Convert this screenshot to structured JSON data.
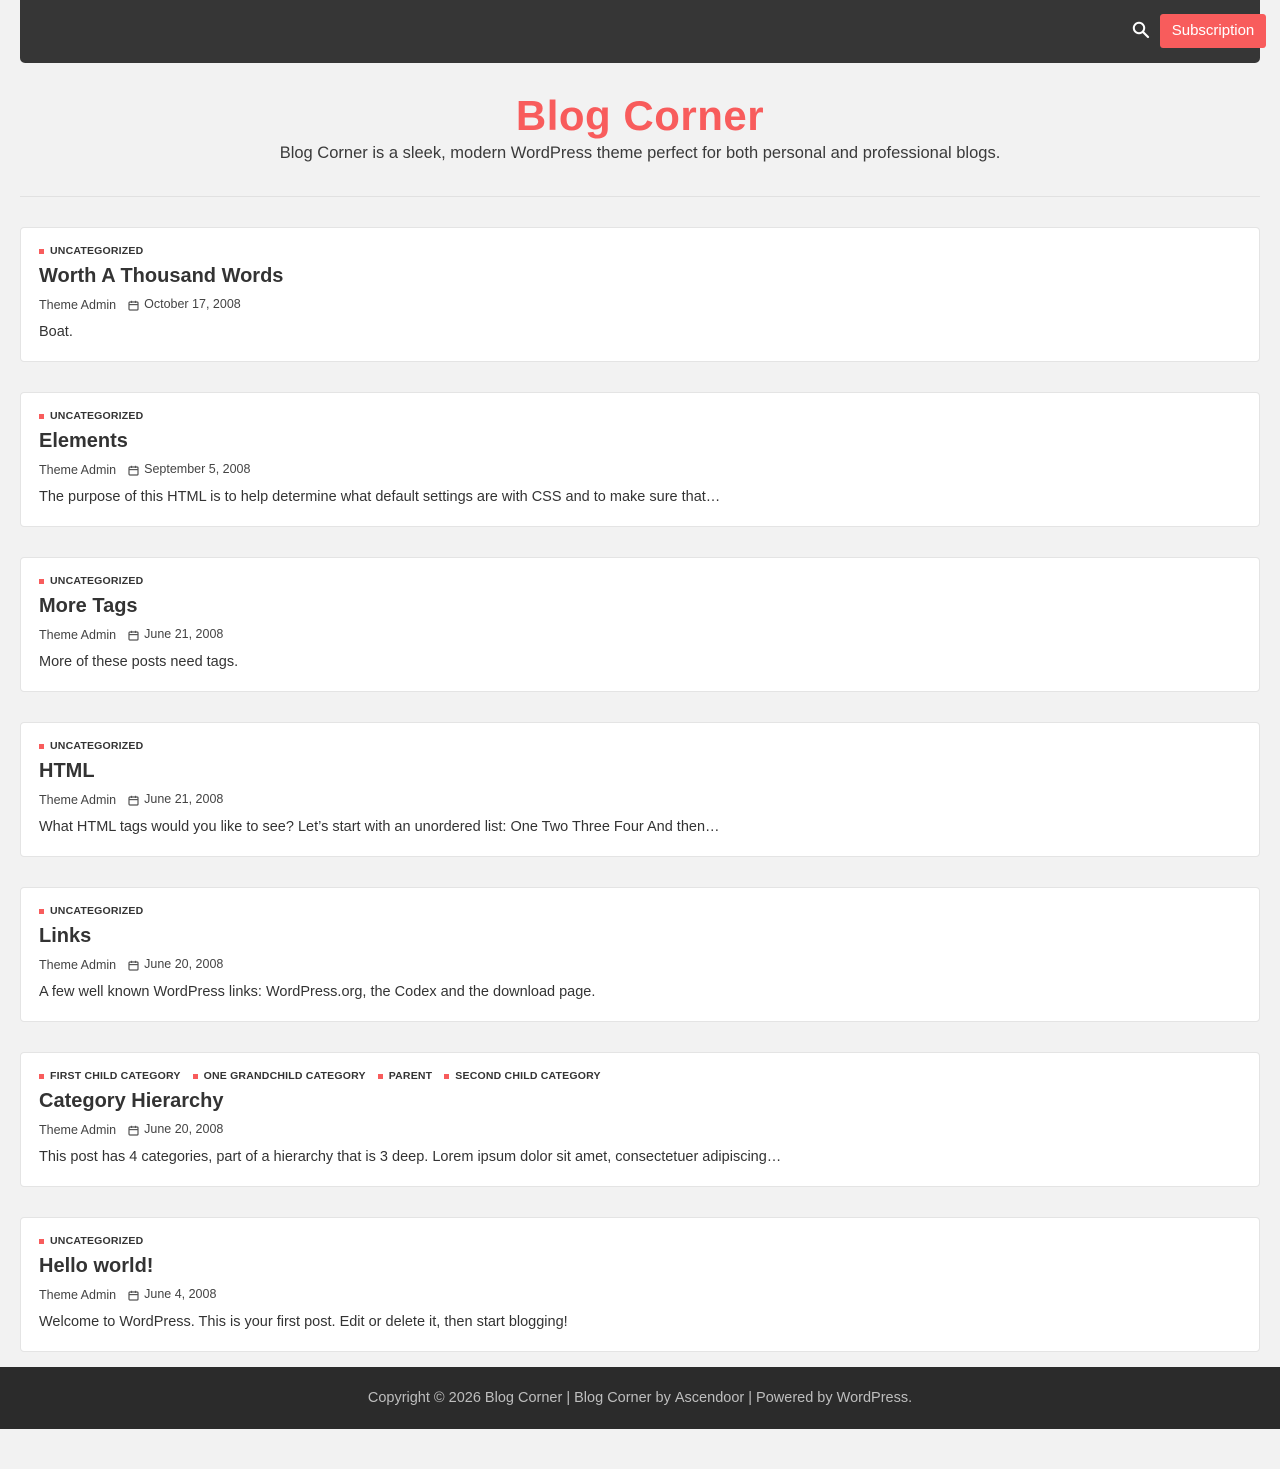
{
  "header": {
    "subscription_label": "Subscription",
    "search_icon": "search-icon",
    "site_title": "Blog Corner",
    "site_description": "Blog Corner is a sleek, modern WordPress theme perfect for both personal and professional blogs."
  },
  "colors": {
    "accent": "#f85c5c",
    "topbar": "#363636",
    "footer": "#2b2b2b",
    "page_background": "#f2f2f2"
  },
  "posts": [
    {
      "categories": [
        "Uncategorized"
      ],
      "title": "Worth A Thousand Words",
      "author": "Theme Admin",
      "date": "October 17, 2008",
      "excerpt": "Boat."
    },
    {
      "categories": [
        "Uncategorized"
      ],
      "title": "Elements",
      "author": "Theme Admin",
      "date": "September 5, 2008",
      "excerpt": "The purpose of this HTML is to help determine what default settings are with CSS and to make sure that…"
    },
    {
      "categories": [
        "Uncategorized"
      ],
      "title": "More Tags",
      "author": "Theme Admin",
      "date": "June 21, 2008",
      "excerpt": "More of these posts need tags."
    },
    {
      "categories": [
        "Uncategorized"
      ],
      "title": "HTML",
      "author": "Theme Admin",
      "date": "June 21, 2008",
      "excerpt": "What HTML tags would you like to see? Let’s start with an unordered list: One Two Three Four And then…"
    },
    {
      "categories": [
        "Uncategorized"
      ],
      "title": "Links",
      "author": "Theme Admin",
      "date": "June 20, 2008",
      "excerpt": "A few well known WordPress links: WordPress.org, the Codex and the download page."
    },
    {
      "categories": [
        "First Child Category",
        "One Grandchild Category",
        "Parent",
        "Second Child Category"
      ],
      "title": "Category Hierarchy",
      "author": "Theme Admin",
      "date": "June 20, 2008",
      "excerpt": "This post has 4 categories, part of a hierarchy that is 3 deep. Lorem ipsum dolor sit amet, consectetuer adipiscing…"
    },
    {
      "categories": [
        "Uncategorized"
      ],
      "title": "Hello world!",
      "author": "Theme Admin",
      "date": "June 4, 2008",
      "excerpt": "Welcome to WordPress. This is your first post. Edit or delete it, then start blogging!"
    }
  ],
  "footer": {
    "copyright": "Copyright © 2026 Blog Corner",
    "sep1": " | ",
    "theme_link": "Blog Corner",
    "by": " by ",
    "author_link": "Ascendoor",
    "sep2": " | ",
    "powered": "Powered by ",
    "wp_link": "WordPress",
    "end": "."
  }
}
